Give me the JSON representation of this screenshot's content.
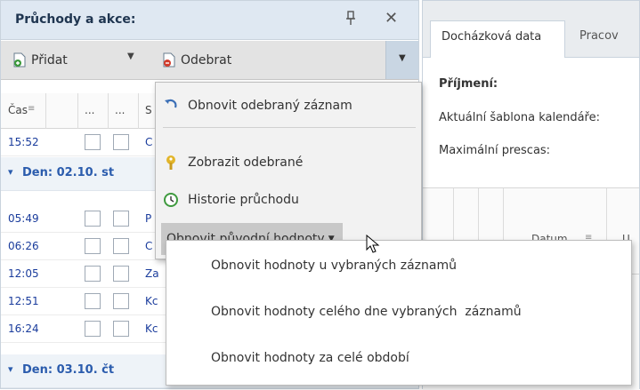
{
  "left_panel": {
    "title": "Průchody a akce:",
    "toolbar": {
      "add_label": "Přidat",
      "remove_label": "Odebrat"
    },
    "columns": [
      "Čas",
      "...",
      "...",
      "S"
    ],
    "rows_before": [
      {
        "time": "15:52",
        "text": "C"
      }
    ],
    "day1": "Den: 02.10. st",
    "rows_day1": [
      {
        "time": "05:49",
        "text": "P"
      },
      {
        "time": "06:26",
        "text": "C"
      },
      {
        "time": "12:05",
        "text": "Za"
      },
      {
        "time": "12:51",
        "text": "Kc"
      },
      {
        "time": "16:24",
        "text": "Kc"
      }
    ],
    "day2": "Den: 03.10. čt"
  },
  "context_menu": {
    "items": [
      {
        "label": "Obnovit odebraný záznam",
        "icon": "undo-icon"
      },
      {
        "label": "Zobrazit odebrané",
        "icon": "key-icon"
      },
      {
        "label": "Historie průchodu",
        "icon": "history-icon"
      },
      {
        "label": "Obnovit původní hodnoty",
        "icon": "chevron-down-icon"
      }
    ],
    "submenu": [
      "Obnovit hodnoty u vybraných záznamů",
      "Obnovit hodnoty celého dne vybraných  záznamů",
      "Obnovit hodnoty za celé období"
    ]
  },
  "right_panel": {
    "tabs": [
      "Docházková data",
      "Pracov"
    ],
    "labels": {
      "surname": "Příjmení:",
      "template": "Aktuální šablona kalendáře:",
      "overtime": "Maximální prescas:"
    },
    "columns": [
      "...",
      "...",
      "...",
      "Datum...",
      "U"
    ]
  },
  "colors": {
    "header_bg": "#dfe8f2",
    "link_blue": "#1a3c9c",
    "day_blue": "#2b5cad",
    "menu_bg": "#f2f2f2",
    "menu_highlight": "#c8c8c8"
  }
}
